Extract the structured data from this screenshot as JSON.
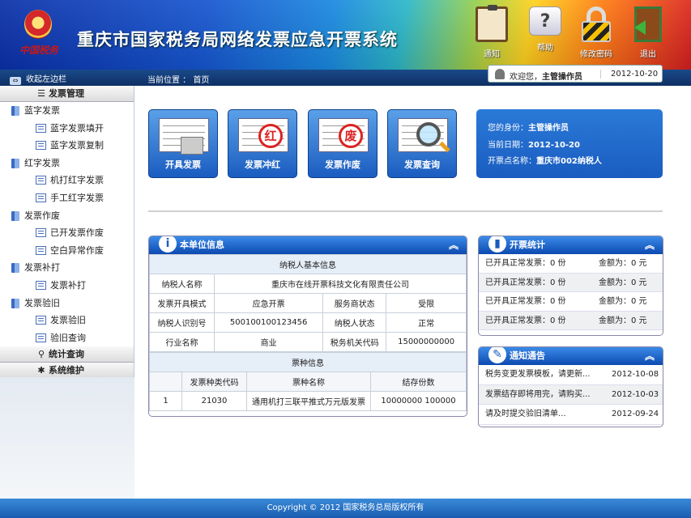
{
  "header": {
    "logo_text": "中国税务",
    "title": "重庆市国家税务局网络发票应急开票系统",
    "buttons": {
      "notice": "通知",
      "help": "帮助",
      "password": "修改密码",
      "exit": "退出"
    }
  },
  "topbar": {
    "collapse": "收起左边栏",
    "location": "当前位置 ： 首页"
  },
  "welcome": {
    "prefix": "欢迎您，",
    "user": "主管操作员",
    "date": "2012-10-20"
  },
  "sidebar": {
    "sections": {
      "invoice_mgmt": "发票管理",
      "stats": "统计查询",
      "system": "系统维护"
    },
    "groups": [
      {
        "label": "蓝字发票",
        "items": [
          "蓝字发票填开",
          "蓝字发票复制"
        ]
      },
      {
        "label": "红字发票",
        "items": [
          "机打红字发票",
          "手工红字发票"
        ]
      },
      {
        "label": "发票作废",
        "items": [
          "已开发票作废",
          "空白异常作废"
        ]
      },
      {
        "label": "发票补打",
        "items": [
          "发票补打"
        ]
      },
      {
        "label": "发票验旧",
        "items": [
          "发票验旧",
          "验旧查询"
        ]
      }
    ]
  },
  "quick": {
    "issue": "开具发票",
    "red": "发票冲红",
    "red_stamp": "红",
    "void": "发票作废",
    "void_stamp": "废",
    "query": "发票查询"
  },
  "info": {
    "role_label": "您的身份：",
    "role": "主管操作员",
    "date_label": "当前日期：",
    "date": "2012-10-20",
    "point_label": "开票点名称：",
    "point": "重庆市002纳税人"
  },
  "unit": {
    "title": "本单位信息",
    "basic_header": "纳税人基本信息",
    "name_label": "纳税人名称",
    "name": "重庆市在线开票科技文化有限责任公司",
    "mode_label": "发票开具模式",
    "mode": "应急开票",
    "provider_label": "服务商状态",
    "provider": "受限",
    "id_label": "纳税人识别号",
    "id": "500100100123456",
    "status_label": "纳税人状态",
    "status": "正常",
    "industry_label": "行业名称",
    "industry": "商业",
    "office_label": "税务机关代码",
    "office": "15000000000",
    "ticket_header": "票种信息",
    "ticket_cols": [
      "发票种类代码",
      "票种名称",
      "结存份数"
    ],
    "tickets": [
      {
        "no": "1",
        "code": "21030",
        "name": "通用机打三联平推式万元版发票",
        "count": "10000000 100000"
      }
    ]
  },
  "stats": {
    "title": "开票统计",
    "rows": [
      {
        "a": "已开具正常发票：0 份",
        "b": "金额为：0 元"
      },
      {
        "a": "已开具正常发票：0 份",
        "b": "金额为：0 元"
      },
      {
        "a": "已开具正常发票：0 份",
        "b": "金额为：0 元"
      },
      {
        "a": "已开具正常发票：0 份",
        "b": "金额为：0 元"
      }
    ]
  },
  "notices": {
    "title": "通知通告",
    "rows": [
      {
        "a": "税务变更发票模板，请更新...",
        "b": "2012-10-08"
      },
      {
        "a": "发票结存即将用完，请购买...",
        "b": "2012-10-03"
      },
      {
        "a": "请及时提交验旧清单...",
        "b": "2012-09-24"
      }
    ]
  },
  "footer": "Copyright © 2012 国家税务总局版权所有"
}
